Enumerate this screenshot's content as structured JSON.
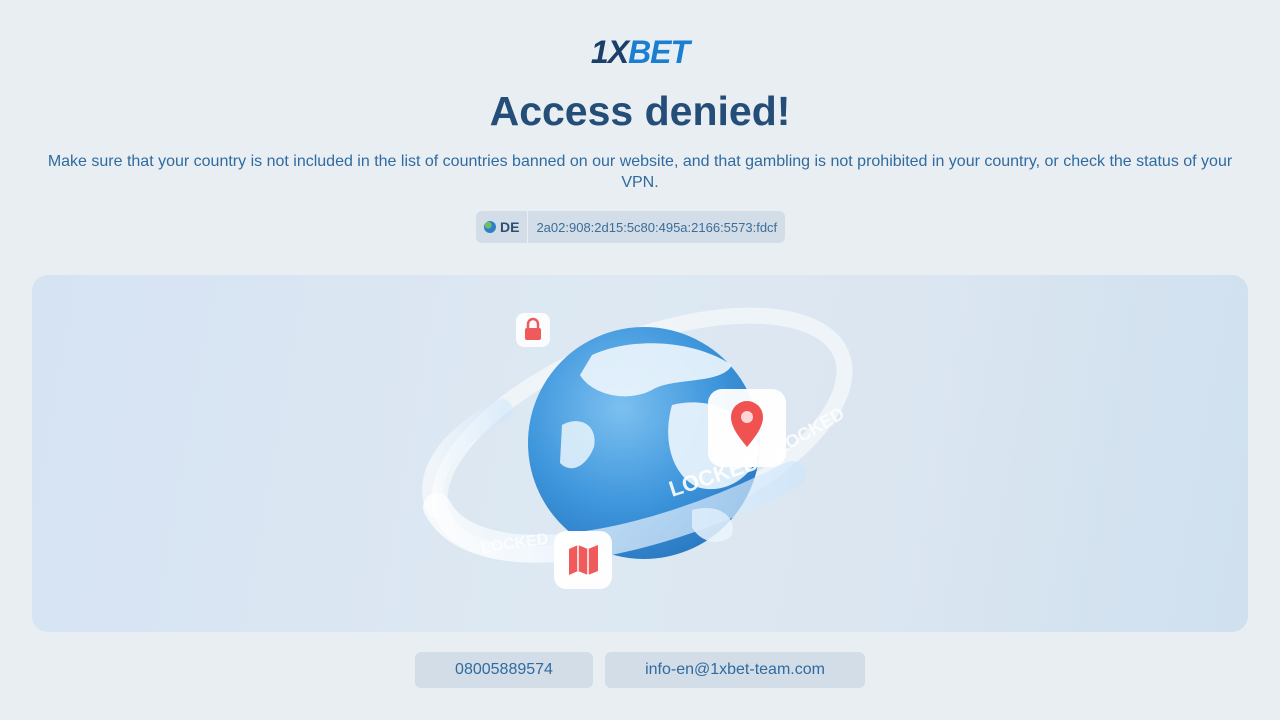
{
  "logo": {
    "part1": "1X",
    "part2": "BET"
  },
  "title": "Access denied!",
  "description": "Make sure that your country is not included in the list of countries banned on our website, and that gambling is not prohibited in your country, or check the status of your VPN.",
  "location": {
    "country_code": "DE",
    "ip_address": "2a02:908:2d15:5c80:495a:2166:5573:fdcf"
  },
  "illustration": {
    "ring_text_1": "LOCKED",
    "ring_text_2": "LOCKED",
    "ring_text_3": "LOCKED"
  },
  "contacts": {
    "phone": "08005889574",
    "email": "info-en@1xbet-team.com"
  },
  "colors": {
    "background": "#e9eef3",
    "title": "#244d78",
    "text": "#2f6ba0",
    "pill": "#d3dde7",
    "accent": "#1a7fd0"
  }
}
